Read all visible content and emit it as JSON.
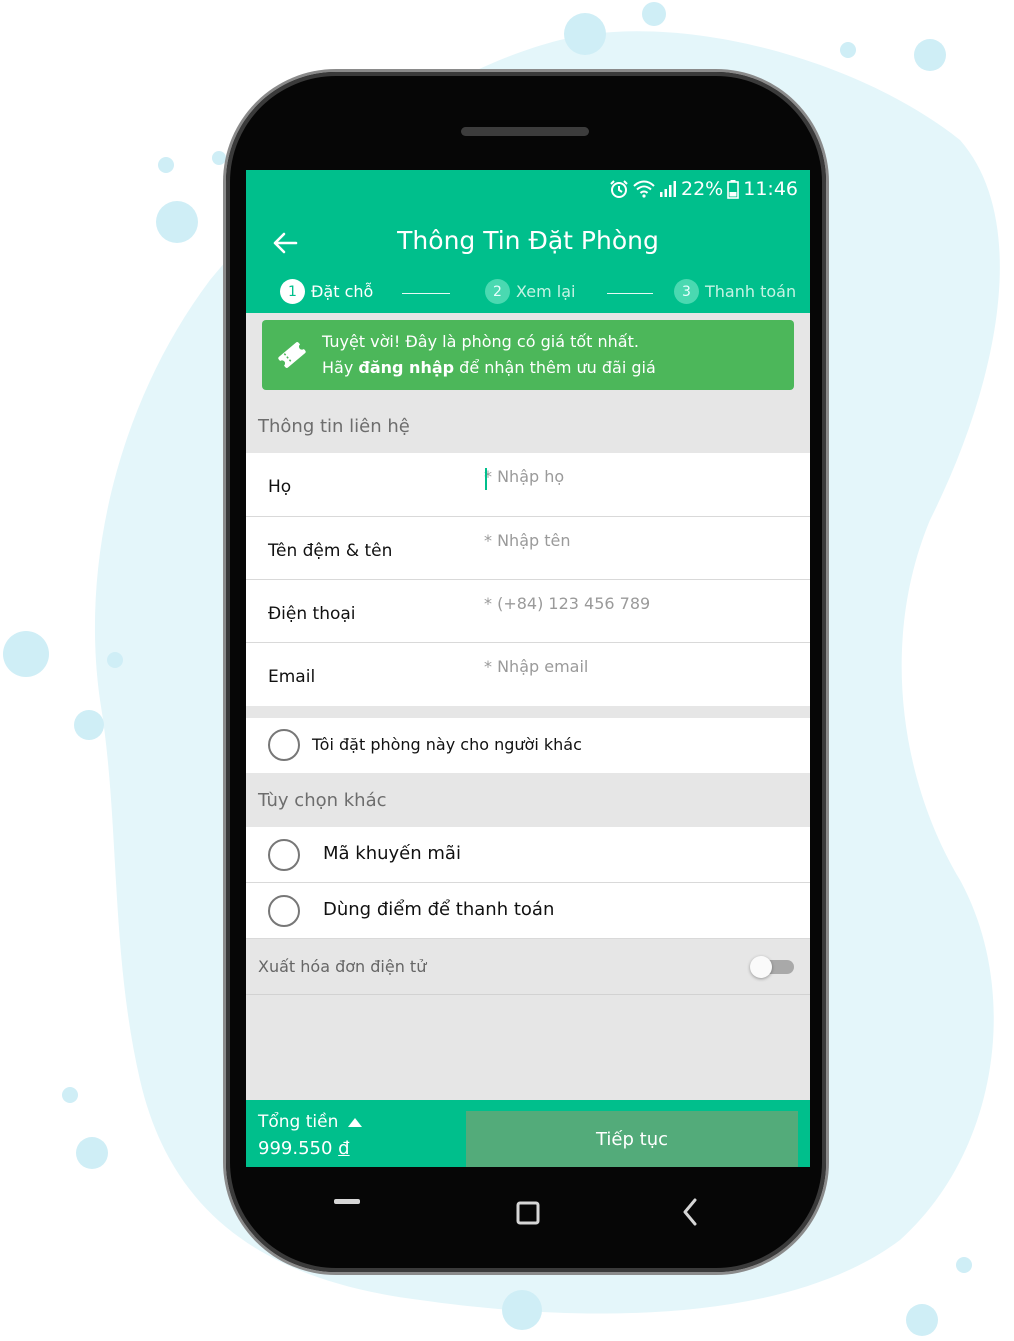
{
  "status_bar": {
    "battery": "22%",
    "time": "11:46",
    "icons": [
      "alarm-icon",
      "wifi-icon",
      "signal-icon",
      "battery-icon"
    ]
  },
  "header": {
    "title": "Thông Tin Đặt Phòng",
    "back_icon": "arrow-left-icon"
  },
  "steps": [
    {
      "number": "1",
      "label": "Đặt chỗ",
      "active": true
    },
    {
      "number": "2",
      "label": "Xem lại",
      "active": false
    },
    {
      "number": "3",
      "label": "Thanh toán",
      "active": false
    }
  ],
  "promo": {
    "line1": "Tuyệt vời! Đây là phòng có giá tốt nhất.",
    "line2_prefix": "Hãy ",
    "line2_bold": "đăng nhập",
    "line2_suffix": " để nhận thêm ưu đãi giá",
    "icon": "ticket-icon"
  },
  "contact": {
    "heading": "Thông tin liên hệ",
    "fields": [
      {
        "label": "Họ",
        "placeholder": "* Nhập họ"
      },
      {
        "label": "Tên đệm & tên",
        "placeholder": "* Nhập tên"
      },
      {
        "label": "Điện thoại",
        "placeholder": "* (+84) 123 456 789"
      },
      {
        "label": "Email",
        "placeholder": "* Nhập email"
      }
    ],
    "other_person_label": "Tôi đặt phòng này cho người khác"
  },
  "options": {
    "heading": "Tùy chọn khác",
    "items": [
      {
        "label": "Mã khuyến mãi"
      },
      {
        "label": "Dùng điểm để thanh toán"
      }
    ],
    "invoice_label": "Xuất hóa đơn điện tử",
    "invoice_enabled": false
  },
  "footer": {
    "total_label": "Tổng tiền",
    "total_value": "999.550",
    "currency": "đ",
    "continue_label": "Tiếp tục"
  },
  "colors": {
    "primary": "#00bf8c",
    "promo": "#4cb75a",
    "button": "#53ab7a",
    "background_blob": "#e4f6fa",
    "bubble": "#cfeef6"
  }
}
